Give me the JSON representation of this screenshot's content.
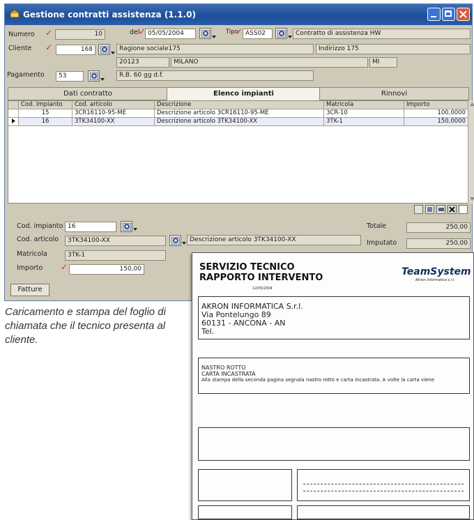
{
  "window": {
    "title": "Gestione contratti assistenza (1.1.0)"
  },
  "header": {
    "numero_label": "Numero",
    "numero_value": "10",
    "del_label": "del",
    "del_value": "05/05/2004",
    "tipo_label": "Tipo",
    "tipo_value": "ASS02",
    "tipo_desc": "Contratto di assistenza HW",
    "cliente_label": "Cliente",
    "cliente_value": "168",
    "ragione_sociale": "Ragione sociale175",
    "indirizzo": "Indirizzo 175",
    "cap": "20123",
    "citta": "MILANO",
    "provincia": "MI",
    "pagamento_label": "Pagamento",
    "pagamento_value": "53",
    "pagamento_desc": "R.B. 60 gg d.f."
  },
  "tabs": [
    {
      "label": "Dati contratto"
    },
    {
      "label": "Elenco impianti"
    },
    {
      "label": "Rinnovi"
    }
  ],
  "grid": {
    "columns": [
      "Cod. Impianto",
      "Cod. articolo",
      "Descrizione",
      "Matricola",
      "Importo"
    ],
    "rows": [
      {
        "impianto": "15",
        "articolo": "3CR16110-95-ME",
        "descrizione": "Descrizione articolo 3CR16110-95-ME",
        "matricola": "3CR-10",
        "importo": "100,0000"
      },
      {
        "impianto": "16",
        "articolo": "3TK34100-XX",
        "descrizione": "Descrizione articolo 3TK34100-XX",
        "matricola": "3TK-1",
        "importo": "150,0000"
      }
    ]
  },
  "detail": {
    "impianto_label": "Cod. impianto",
    "impianto_value": "16",
    "articolo_label": "Cod. articolo",
    "articolo_value": "3TK34100-XX",
    "articolo_desc": "Descrizione articolo 3TK34100-XX",
    "matricola_label": "Matricola",
    "matricola_value": "3TK-1",
    "importo_label": "Importo",
    "importo_value": "150,00",
    "totale_label": "Totale",
    "totale_value": "250,00",
    "imputato_label": "Imputato",
    "imputato_value": "250,00"
  },
  "buttons": {
    "fatture": "Fatture"
  },
  "caption": "Caricamento e stampa del foglio di chiamata che il tecnico presenta al cliente.",
  "report": {
    "title1": "SERVIZIO TECNICO",
    "title2": "RAPPORTO INTERVENTO",
    "logo": "TeamSystem",
    "logo_sub": "Akron Informatica s.r.l.",
    "cliente_lines": [
      "AKRON INFORMATICA S.r.l.",
      "Via Pontelungo 89",
      "60131 - ANCONA - AN",
      "Tel."
    ],
    "motivo_lines": [
      "NASTRO ROTTO",
      "CARTA INCASTRATA",
      "Alla stampa della seconda pagina segnala nastro rotto e carta incastrata. A volte la carta viene"
    ],
    "data_chiamata": "12/05/2004"
  },
  "colors": {
    "titlebar": "#1c4e9a",
    "window_bg": "#cfcab8",
    "required_check": "#d42a1c"
  }
}
